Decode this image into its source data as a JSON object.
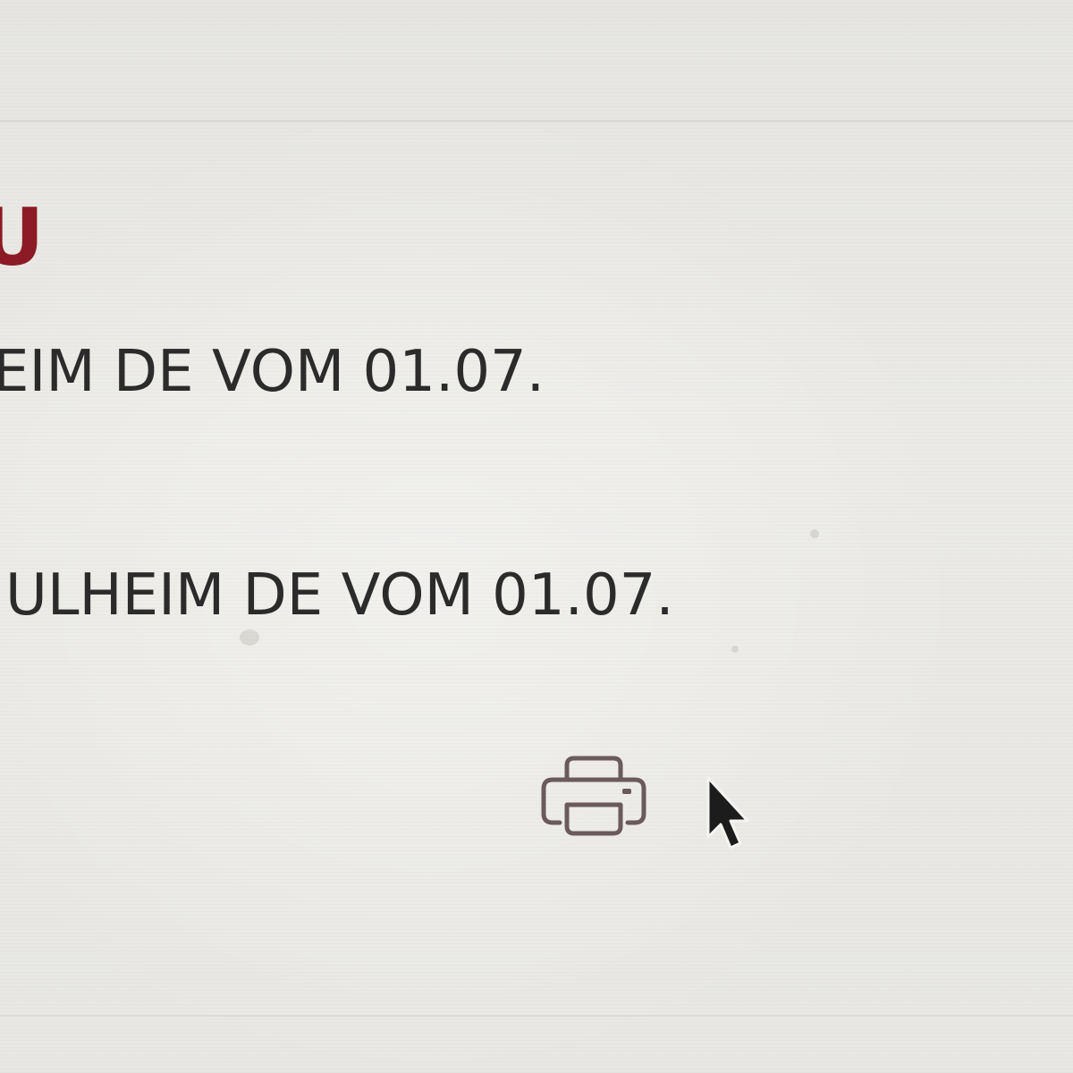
{
  "document": {
    "heading_mark": "U",
    "entries": [
      {
        "text": "EIM DE VOM 01.07."
      },
      {
        "text": "ULHEIM DE VOM 01.07."
      }
    ]
  },
  "toolbar": {
    "print_icon": "printer-icon",
    "cursor_icon": "mouse-pointer-icon"
  },
  "colors": {
    "background": "#e9e8e4",
    "text": "#2b2b2b",
    "accent": "#8c1b26",
    "icon": "#6a5a5c"
  }
}
